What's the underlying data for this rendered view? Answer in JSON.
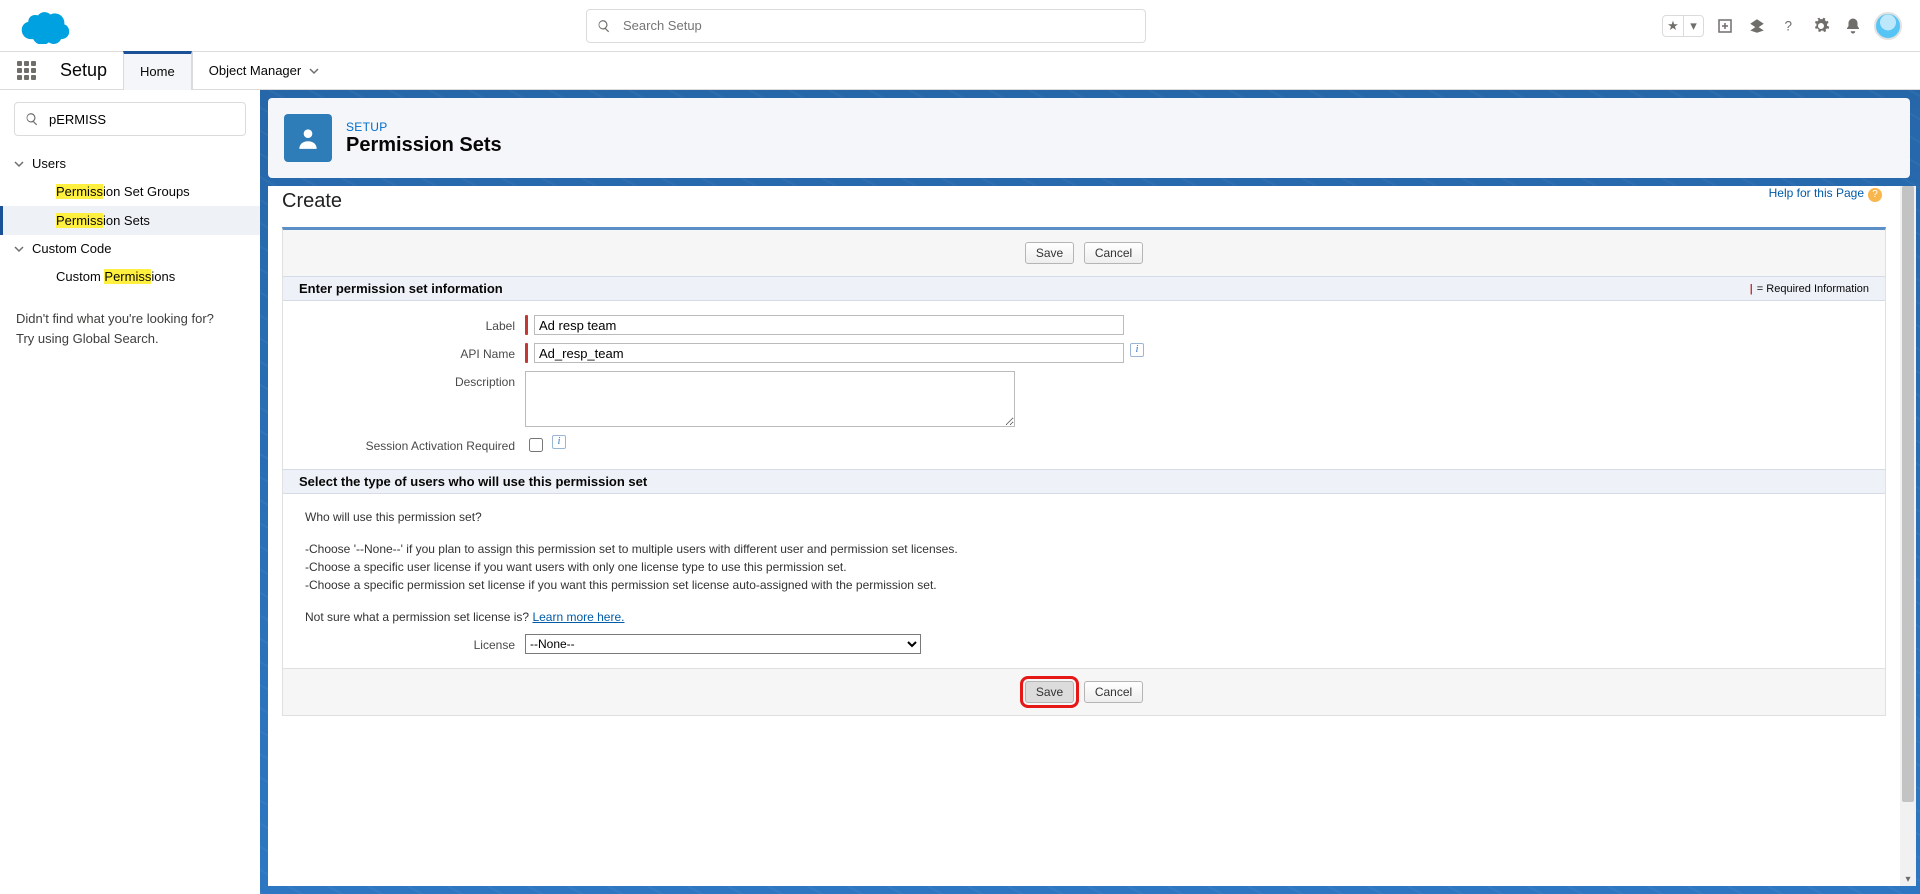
{
  "header": {
    "search_placeholder": "Search Setup"
  },
  "nav": {
    "app_name": "Setup",
    "home": "Home",
    "object_manager": "Object Manager"
  },
  "sidebar": {
    "quick_find_value": "pERMISS",
    "cat_users": "Users",
    "item_psg_pre": "Permiss",
    "item_psg_post": "ion Set Groups",
    "item_ps_pre": "Permiss",
    "item_ps_post": "ion Sets",
    "cat_custom": "Custom Code",
    "item_cp_pre": "Custom ",
    "item_cp_mid": "Permiss",
    "item_cp_post": "ions",
    "nf1": "Didn't find what you're looking for?",
    "nf2": "Try using Global Search."
  },
  "page": {
    "eyebrow": "SETUP",
    "title": "Permission Sets"
  },
  "classic": {
    "help_link": "Help for this Page",
    "title": "Create",
    "btn_save": "Save",
    "btn_cancel": "Cancel",
    "sec1_title": "Enter permission set information",
    "req_info": "= Required Information",
    "lbl_label": "Label",
    "val_label": "Ad resp team",
    "lbl_api": "API Name",
    "val_api": "Ad_resp_team",
    "lbl_desc": "Description",
    "lbl_sess": "Session Activation Required",
    "sec2_title": "Select the type of users who will use this permission set",
    "q": "Who will use this permission set?",
    "b1": "-Choose '--None--' if you plan to assign this permission set to multiple users with different user and permission set licenses.",
    "b2": "-Choose a specific user license if you want users with only one license type to use this permission set.",
    "b3": "-Choose a specific permission set license if you want this permission set license auto-assigned with the permission set.",
    "ns": "Not sure what a permission set license is? ",
    "learn": "Learn more here.",
    "lbl_license": "License",
    "license_value": "--None--"
  }
}
